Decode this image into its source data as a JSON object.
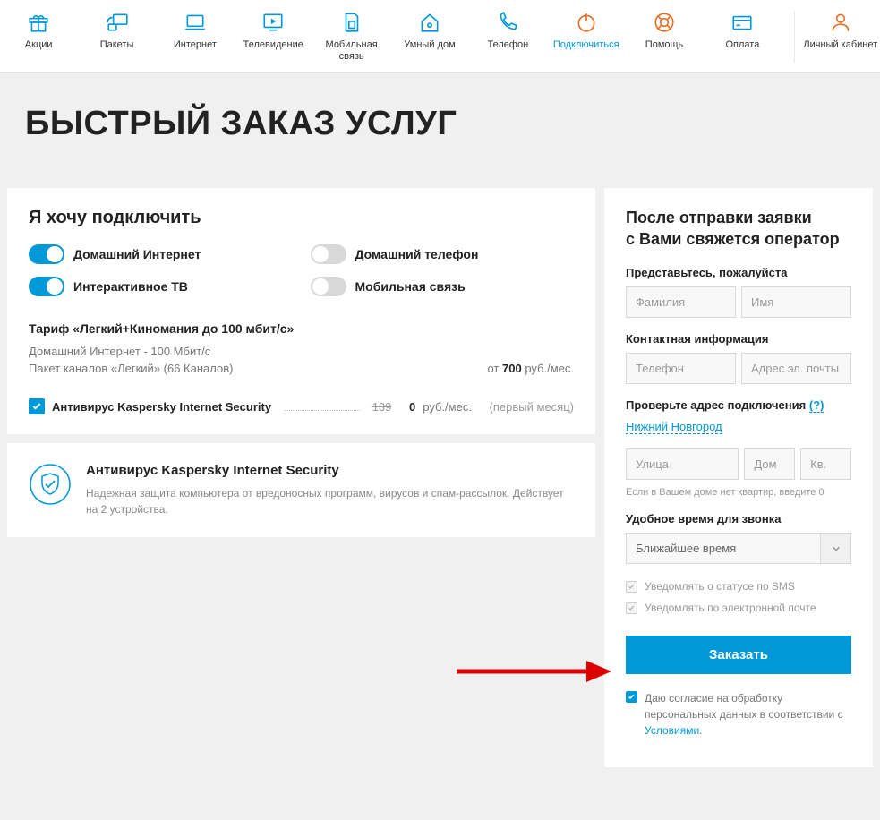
{
  "nav": [
    {
      "label": "Акции"
    },
    {
      "label": "Пакеты"
    },
    {
      "label": "Интернет"
    },
    {
      "label": "Телевидение"
    },
    {
      "label": "Мобильная связь"
    },
    {
      "label": "Умный дом"
    },
    {
      "label": "Телефон"
    },
    {
      "label": "Подключиться"
    },
    {
      "label": "Помощь"
    },
    {
      "label": "Оплата"
    },
    {
      "label": "Личный кабинет"
    }
  ],
  "page_title": "БЫСТРЫЙ ЗАКАЗ УСЛУГ",
  "connect_section": {
    "heading": "Я хочу подключить",
    "toggles": [
      {
        "label": "Домашний Интернет",
        "on": true
      },
      {
        "label": "Домашний телефон",
        "on": false
      },
      {
        "label": "Интерактивное ТВ",
        "on": true
      },
      {
        "label": "Мобильная связь",
        "on": false
      }
    ],
    "tariff_name": "Тариф «Легкий+Киномания до 100 мбит/с»",
    "tariff_line1": "Домашний Интернет - 100 Мбит/с",
    "tariff_line2": "Пакет каналов «Легкий» (66 Каналов)",
    "price_prefix": "от ",
    "price_value": "700",
    "price_unit": " руб./мес.",
    "addon": {
      "name": "Антивирус Kaspersky Internet Security",
      "old_price": "139",
      "new_price": "0",
      "unit": " руб./мес.",
      "note": "(первый месяц)"
    }
  },
  "info_card": {
    "title": "Антивирус Kaspersky Internet Security",
    "text": "Надежная защита компьютера от вредоносных программ, вирусов и спам-рассылок. Действует на 2 устройства."
  },
  "form": {
    "heading_l1": "После отправки заявки",
    "heading_l2": "с Вами свяжется оператор",
    "name_label": "Представьтесь, пожалуйста",
    "ph_lastname": "Фамилия",
    "ph_firstname": "Имя",
    "contact_label": "Контактная информация",
    "ph_phone": "Телефон",
    "ph_email": "Адрес эл. почты",
    "address_label": "Проверьте адрес подключения ",
    "q": "(?)",
    "city": "Нижний Новгород",
    "ph_street": "Улица",
    "ph_house": "Дом",
    "ph_apt": "Кв.",
    "apt_hint": "Если в Вашем доме нет квартир, введите 0",
    "time_label": "Удобное время для звонка",
    "time_value": "Ближайшее время",
    "sms_notify": "Уведомлять о статусе по SMS",
    "email_notify": "Уведомлять по электронной почте",
    "order_btn": "Заказать",
    "consent_text": "Даю согласие на обработку персональных данных в соответствии с ",
    "consent_link": "Условиями",
    "consent_dot": "."
  }
}
